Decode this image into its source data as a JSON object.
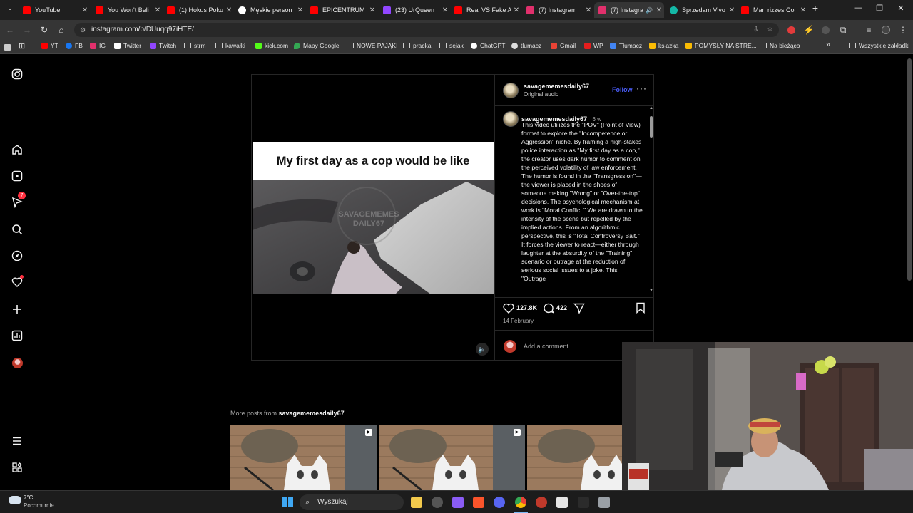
{
  "browser": {
    "tabs": [
      {
        "title": "YouTube",
        "color": "#ff0000"
      },
      {
        "title": "You Won't Beli",
        "color": "#ff0000"
      },
      {
        "title": "(1) Hokus Poku",
        "color": "#ff0000"
      },
      {
        "title": "Męskie person",
        "color": "#ffffff"
      },
      {
        "title": "EPICENTRUM |",
        "color": "#ff0000"
      },
      {
        "title": "(23) UrQueen",
        "color": "#9146ff"
      },
      {
        "title": "Real VS Fake A",
        "color": "#ff0000"
      },
      {
        "title": "(7) Instagram",
        "color": "#e1306c"
      },
      {
        "title": "(7) Instagra",
        "color": "#e1306c"
      },
      {
        "title": "Sprzedam Vivo",
        "color": "#14b8a6"
      },
      {
        "title": "Man rizzes Co",
        "color": "#ff0000"
      }
    ],
    "url": "instagram.com/p/DUuqq97iHTE/",
    "bookmarks": [
      {
        "label": "YT",
        "kind": "icon",
        "color": "#ff0000"
      },
      {
        "label": "FB",
        "kind": "icon",
        "color": "#1877f2"
      },
      {
        "label": "IG",
        "kind": "icon",
        "color": "#e1306c"
      },
      {
        "label": "Twitter",
        "kind": "icon",
        "color": "#ffffff"
      },
      {
        "label": "Twitch",
        "kind": "icon",
        "color": "#9146ff"
      },
      {
        "label": "strm",
        "kind": "folder"
      },
      {
        "label": "kawałki",
        "kind": "folder"
      },
      {
        "label": "kick.com",
        "kind": "icon",
        "color": "#53fc18"
      },
      {
        "label": "Mapy Google",
        "kind": "icon",
        "color": "#34a853"
      },
      {
        "label": "NOWE PAJĄKI",
        "kind": "folder"
      },
      {
        "label": "pracka",
        "kind": "folder"
      },
      {
        "label": "sejak",
        "kind": "folder"
      },
      {
        "label": "ChatGPT",
        "kind": "icon",
        "color": "#ffffff"
      },
      {
        "label": "tlumacz",
        "kind": "icon",
        "color": "#dddddd"
      },
      {
        "label": "Gmail",
        "kind": "icon",
        "color": "#ea4335"
      },
      {
        "label": "WP",
        "kind": "icon",
        "color": "#e51d1d"
      },
      {
        "label": "Tłumacz",
        "kind": "icon",
        "color": "#4285f4"
      },
      {
        "label": "ksiazka",
        "kind": "icon",
        "color": "#fbbc04"
      },
      {
        "label": "POMYSŁY NA STRE...",
        "kind": "icon",
        "color": "#fbbc04"
      },
      {
        "label": "Na bieżąco",
        "kind": "folder"
      }
    ],
    "all_bookmarks": "Wszystkie zakładki"
  },
  "sidebar": {
    "notification_badge": "7",
    "icons": [
      "instagram-logo-icon",
      "home-icon",
      "reels-icon",
      "messages-icon",
      "search-icon",
      "explore-icon",
      "notifications-icon",
      "create-icon",
      "dashboard-icon",
      "profile-avatar",
      "menu-icon",
      "also-from-meta-icon"
    ]
  },
  "post": {
    "video_caption": "My first day as a cop would be like",
    "watermark": "SAVAGEMEMES DAILY67",
    "username": "savagememesdaily67",
    "audio": "Original audio",
    "follow": "Follow",
    "comment_username": "savagememesdaily67",
    "comment_age": "6 w",
    "description": "This video utilizes the \"POV\" (Point of View) format to explore the \"Incompetence or Aggression\" niche. By framing a high-stakes police interaction as \"My first day as a cop,\" the creator uses dark humor to comment on the perceived volatility of law enforcement. The humor is found in the \"Transgression\"—the viewer is placed in the shoes of someone making \"Wrong\" or \"Over-the-top\" decisions. The psychological mechanism at work is \"Moral Conflict.\" We are drawn to the intensity of the scene but repelled by the implied actions. From an algorithmic perspective, this is \"Total Controversy Bait.\" It forces the viewer to react—either through laughter at the absurdity of the \"Training\" scenario or outrage at the reduction of serious social issues to a joke. This \"Outrage",
    "likes": "127.8K",
    "comments": "422",
    "date": "14 February",
    "add_comment_placeholder": "Add a comment...",
    "accent": "#4a5df9"
  },
  "more_posts": {
    "prefix": "More posts from ",
    "username": "savagememesdaily67"
  },
  "taskbar": {
    "temperature": "7°C",
    "weather": "Pochmurnie",
    "search_placeholder": "Wyszukaj"
  }
}
